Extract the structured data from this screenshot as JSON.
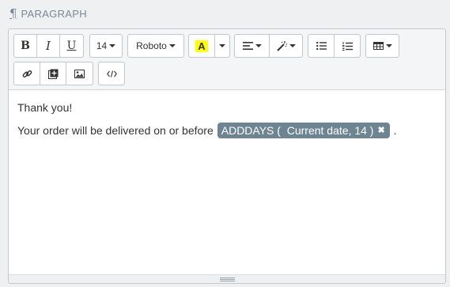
{
  "section": {
    "title": "PARAGRAPH",
    "icon": "pilcrow-icon",
    "icon_glyph": "¶"
  },
  "toolbar": {
    "bold_label": "B",
    "italic_label": "I",
    "underline_label": "U",
    "font_size": "14",
    "font_family": "Roboto",
    "highlight_label": "A",
    "highlight_color": "#ffff00"
  },
  "content": {
    "line1": "Thank you!",
    "line2_prefix": "Your order will be delivered on or before",
    "chip_text": "ADDDAYS (  Current date, 14 )",
    "chip_color": "#6d8593",
    "line2_suffix": "."
  }
}
